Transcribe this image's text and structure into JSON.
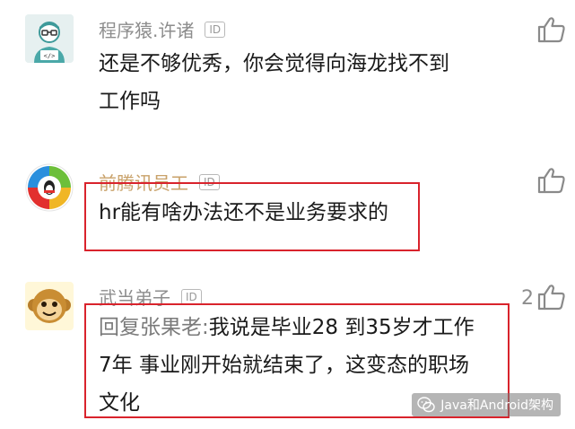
{
  "comments": [
    {
      "name": "程序猿.许诸",
      "id_badge": "ID",
      "text_lines": [
        "还是不够优秀，你会觉得向海龙找不到",
        "工作吗"
      ],
      "likes": ""
    },
    {
      "name": "前腾讯员工",
      "id_badge": "ID",
      "text_lines": [
        "hr能有啥办法还不是业务要求的"
      ],
      "likes": ""
    },
    {
      "name": "武当弟子",
      "id_badge": "ID",
      "reply_prefix": "回复张果老:",
      "text_lines": [
        "我说是毕业28 到35岁才工作",
        "7年 事业刚开始就结束了，这变态的职场",
        "文化"
      ],
      "likes": "2"
    }
  ],
  "watermark": "Java和Android架构",
  "colors": {
    "highlight_box": "#d9232c",
    "name_text": "#8d8d8d",
    "body_text": "#1a1a1a"
  },
  "icons": [
    "avatar-programmer-icon",
    "avatar-qq-logo",
    "avatar-monkey-icon",
    "thumbs-up-icon",
    "wechat-icon"
  ]
}
